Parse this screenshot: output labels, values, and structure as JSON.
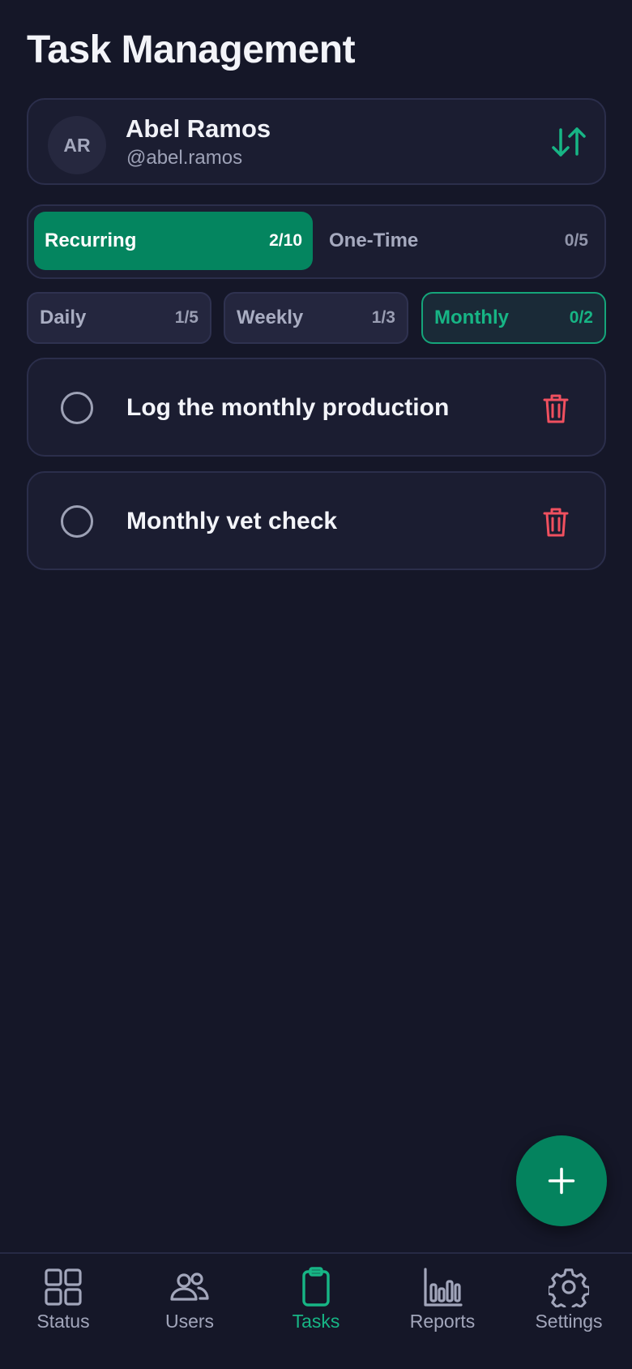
{
  "header": {
    "title": "Task Management"
  },
  "user": {
    "initials": "AR",
    "name": "Abel Ramos",
    "handle": "@abel.ramos"
  },
  "type_tabs": [
    {
      "label": "Recurring",
      "count": "2/10",
      "active": true
    },
    {
      "label": "One-Time",
      "count": "0/5",
      "active": false
    }
  ],
  "frequency_tabs": [
    {
      "label": "Daily",
      "count": "1/5",
      "active": false
    },
    {
      "label": "Weekly",
      "count": "1/3",
      "active": false
    },
    {
      "label": "Monthly",
      "count": "0/2",
      "active": true
    }
  ],
  "tasks": [
    {
      "title": "Log the monthly production",
      "completed": false
    },
    {
      "title": "Monthly vet check",
      "completed": false
    }
  ],
  "nav": [
    {
      "label": "Status",
      "icon": "grid-icon",
      "active": false
    },
    {
      "label": "Users",
      "icon": "users-icon",
      "active": false
    },
    {
      "label": "Tasks",
      "icon": "clipboard-icon",
      "active": true
    },
    {
      "label": "Reports",
      "icon": "bar-chart-icon",
      "active": false
    },
    {
      "label": "Settings",
      "icon": "gear-icon",
      "active": false
    }
  ],
  "colors": {
    "background": "#151728",
    "card": "#1b1d31",
    "accent": "#04855f",
    "accent_text": "#17b585",
    "delete": "#f0505f"
  }
}
